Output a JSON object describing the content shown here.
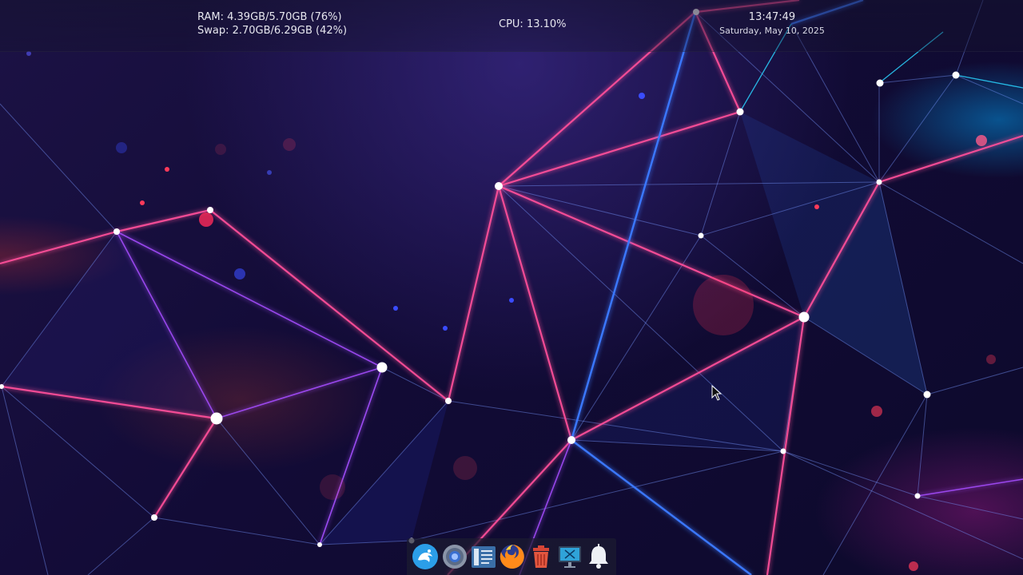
{
  "system_monitor": {
    "ram": "RAM: 4.39GB/5.70GB (76%)",
    "swap": "Swap: 2.70GB/6.29GB (42%)",
    "cpu": "CPU: 13.10%"
  },
  "clock": {
    "time": "13:47:49",
    "date": "Saturday, May 10, 2025"
  },
  "dock": {
    "items": [
      {
        "icon": "app-launcher-icon"
      },
      {
        "icon": "web-browser-icon"
      },
      {
        "icon": "file-manager-icon"
      },
      {
        "icon": "firefox-icon"
      },
      {
        "icon": "trash-icon"
      },
      {
        "icon": "display-settings-icon"
      },
      {
        "icon": "notifications-bell-icon"
      }
    ]
  },
  "colors": {
    "background": "#110b2e",
    "accent_pink": "#ff3a8c",
    "accent_blue": "#2f6bff",
    "accent_cyan": "#1fc6ff",
    "text": "#e6e6ee"
  }
}
